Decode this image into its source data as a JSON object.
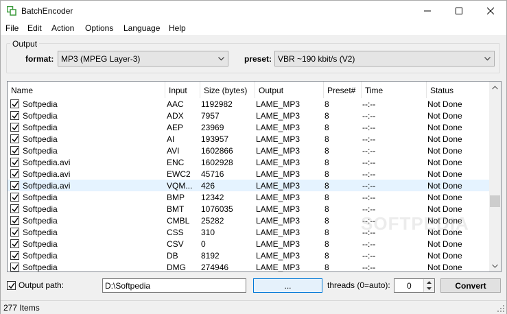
{
  "window": {
    "title": "BatchEncoder"
  },
  "menu": [
    "File",
    "Edit",
    "Action",
    "Options",
    "Language",
    "Help"
  ],
  "output_group": {
    "label": "Output",
    "format_label": "format:",
    "format_value": "MP3 (MPEG Layer-3)",
    "preset_label": "preset:",
    "preset_value": "VBR ~190 kbit/s (V2)"
  },
  "list": {
    "columns": [
      "Name",
      "Input",
      "Size (bytes)",
      "Output",
      "Preset#",
      "Time",
      "Status"
    ],
    "rows": [
      {
        "name": "Softpedia",
        "input": "AAC",
        "size": "1192982",
        "output": "LAME_MP3",
        "preset": "8",
        "time": "--:--",
        "status": "Not Done"
      },
      {
        "name": "Softpedia",
        "input": "ADX",
        "size": "7957",
        "output": "LAME_MP3",
        "preset": "8",
        "time": "--:--",
        "status": "Not Done"
      },
      {
        "name": "Softpedia",
        "input": "AEP",
        "size": "23969",
        "output": "LAME_MP3",
        "preset": "8",
        "time": "--:--",
        "status": "Not Done"
      },
      {
        "name": "Softpedia",
        "input": "AI",
        "size": "193957",
        "output": "LAME_MP3",
        "preset": "8",
        "time": "--:--",
        "status": "Not Done"
      },
      {
        "name": "Softpedia",
        "input": "AVI",
        "size": "1602866",
        "output": "LAME_MP3",
        "preset": "8",
        "time": "--:--",
        "status": "Not Done"
      },
      {
        "name": "Softpedia.avi",
        "input": "ENC",
        "size": "1602928",
        "output": "LAME_MP3",
        "preset": "8",
        "time": "--:--",
        "status": "Not Done"
      },
      {
        "name": "Softpedia.avi",
        "input": "EWC2",
        "size": "45716",
        "output": "LAME_MP3",
        "preset": "8",
        "time": "--:--",
        "status": "Not Done"
      },
      {
        "name": "Softpedia.avi",
        "input": "VQM...",
        "size": "426",
        "output": "LAME_MP3",
        "preset": "8",
        "time": "--:--",
        "status": "Not Done"
      },
      {
        "name": "Softpedia",
        "input": "BMP",
        "size": "12342",
        "output": "LAME_MP3",
        "preset": "8",
        "time": "--:--",
        "status": "Not Done"
      },
      {
        "name": "Softpedia",
        "input": "BMT",
        "size": "1076035",
        "output": "LAME_MP3",
        "preset": "8",
        "time": "--:--",
        "status": "Not Done"
      },
      {
        "name": "Softpedia",
        "input": "CMBL",
        "size": "25282",
        "output": "LAME_MP3",
        "preset": "8",
        "time": "--:--",
        "status": "Not Done"
      },
      {
        "name": "Softpedia",
        "input": "CSS",
        "size": "310",
        "output": "LAME_MP3",
        "preset": "8",
        "time": "--:--",
        "status": "Not Done"
      },
      {
        "name": "Softpedia",
        "input": "CSV",
        "size": "0",
        "output": "LAME_MP3",
        "preset": "8",
        "time": "--:--",
        "status": "Not Done"
      },
      {
        "name": "Softpedia",
        "input": "DB",
        "size": "8192",
        "output": "LAME_MP3",
        "preset": "8",
        "time": "--:--",
        "status": "Not Done"
      },
      {
        "name": "Softpedia",
        "input": "DMG",
        "size": "274946",
        "output": "LAME_MP3",
        "preset": "8",
        "time": "--:--",
        "status": "Not Done"
      }
    ]
  },
  "watermark": "SOFTPEDIA",
  "bottom": {
    "output_path_label": "Output path:",
    "output_path_value": "D:\\Softpedia",
    "browse_label": "...",
    "threads_label": "threads (0=auto):",
    "threads_value": "0",
    "convert_label": "Convert"
  },
  "status": {
    "items": "277 Items"
  }
}
